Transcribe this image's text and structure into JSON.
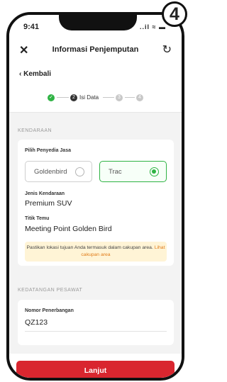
{
  "status": {
    "time": "9:41",
    "signal": "..il ≈ ▬"
  },
  "badge": "4",
  "appbar": {
    "title": "Informasi Penjemputan"
  },
  "nav": {
    "back_label": "Kembali"
  },
  "stepper": {
    "steps": [
      {
        "label": "",
        "state": "done",
        "number": "✓"
      },
      {
        "label": "Isi Data",
        "state": "active",
        "number": "2"
      },
      {
        "label": "",
        "state": "pending",
        "number": "3"
      },
      {
        "label": "",
        "state": "pending",
        "number": "4"
      }
    ]
  },
  "vehicle_section": {
    "heading": "KENDARAAN",
    "provider_label": "Pilih Penyedia Jasa",
    "providers": [
      {
        "name": "Goldenbird",
        "selected": false
      },
      {
        "name": "Trac",
        "selected": true
      }
    ],
    "vehicle_type_label": "Jenis Kendaraan",
    "vehicle_type_value": "Premium SUV",
    "meeting_point_label": "Titik Temu",
    "meeting_point_value": "Meeting Point Golden Bird",
    "notice_text": "Pastikan lokasi tujuan Anda termasuk dalam cakupan area.",
    "notice_link": "Lihat cakupan area"
  },
  "arrival_section": {
    "heading": "KEDATANGAN PESAWAT",
    "flight_label": "Nomor Penerbangan",
    "flight_value": "QZ123"
  },
  "footer": {
    "cta_label": "Lanjut"
  },
  "colors": {
    "accent_green": "#2fb344",
    "cta_red": "#d9262f",
    "notice_bg": "#fff4d6",
    "link_orange": "#e07b18"
  }
}
